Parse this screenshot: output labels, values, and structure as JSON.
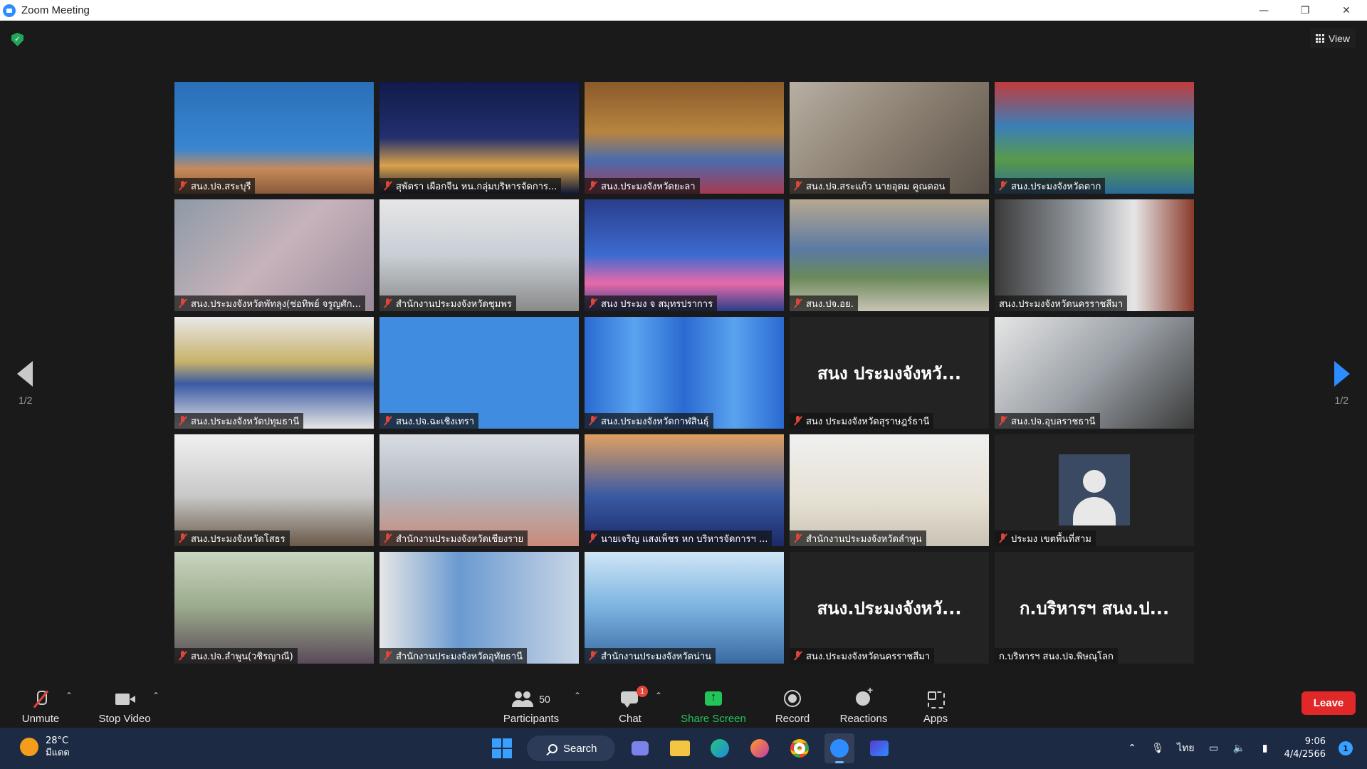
{
  "window": {
    "title": "Zoom Meeting"
  },
  "header": {
    "view_label": "View"
  },
  "pagination": {
    "left": "1/2",
    "right": "1/2"
  },
  "tiles": [
    {
      "name": "สนง.ปจ.สระบุรี",
      "bg": "linear-gradient(180deg,#2a6fb8 0%,#3a86d1 60%,#c68a5a 78%,#8a5a3a 100%)",
      "muted": true
    },
    {
      "name": "สุพัตรา เผือกจีน  หน.กลุ่มบริหารจัดการ...",
      "bg": "linear-gradient(180deg,#101a4a 0%,#23306e 50%,#d9a24a 75%,#0e1838 100%)",
      "muted": true
    },
    {
      "name": "สนง.ประมงจังหวัดยะลา",
      "bg": "linear-gradient(180deg,#8a5a2a 0%,#b88440 45%,#4a6cae 70%,#a63a52 100%)",
      "muted": true
    },
    {
      "name": "สนง.ปจ.สระแก้ว นายอุดม คูณดอน",
      "bg": "linear-gradient(135deg,#b7b0a3 0%,#8a7e70 50%,#5a5249 100%)",
      "muted": true
    },
    {
      "name": "สนง.ประมงจังหวัดตาก",
      "bg": "linear-gradient(180deg,#c23b3b 0%,#3a7fb8 40%,#5a9a4a 70%,#2a6a9a 100%)",
      "muted": true
    },
    {
      "name": "สนง.ประมงจังหวัดพัทลุง(ช่อทิพย์ จรูญศัก...",
      "bg": "linear-gradient(135deg,#8c9aa6 0%,#c7b3bb 50%,#9a8a9a 100%)",
      "muted": true
    },
    {
      "name": "สำนักงานประมงจังหวัดชุมพร",
      "bg": "linear-gradient(180deg,#e6e6e6 0%,#c9cfd6 50%,#8a8a8a 100%)",
      "muted": true
    },
    {
      "name": "สนง ประมง จ สมุทรปราการ",
      "bg": "linear-gradient(180deg,#2a3e8a 0%,#3c6bd1 50%,#e86aa8 75%,#2a3e8a 100%)",
      "muted": true
    },
    {
      "name": "สนง.ปจ.อย.",
      "bg": "linear-gradient(180deg,#b7a890 0%,#5a7aa3 45%,#6a8a5a 70%,#c9c3b5 100%)",
      "muted": true
    },
    {
      "name": "สนง.ประมงจังหวัดนครราชสีมา",
      "bg": "linear-gradient(90deg,#3a3a3a 0%,#9aa0a6 45%,#e6e6e6 70%,#8a3a2a 100%)",
      "muted": false
    },
    {
      "name": "สนง.ประมงจังหวัดปทุมธานี",
      "bg": "linear-gradient(180deg,#e8e8e8 0%,#c9b26a 40%,#3a5aa3 60%,#e6e6e6 100%)",
      "muted": true
    },
    {
      "name": "สนง.ปจ.ฉะเชิงเทรา",
      "bg": "#3f8ce0",
      "muted": true
    },
    {
      "name": "สนง.ประมงจังหวัดกาฬสินธุ์",
      "bg": "linear-gradient(90deg,#2a6ad1 0%,#5aa3f0 25%,#2a6ad1 50%,#5aa3f0 75%,#2a6ad1 100%)",
      "muted": true
    },
    {
      "name": "สนง ประมงจังหวัดสุราษฎร์ธานี",
      "big": "สนง ประมงจังหวั...",
      "bg": "#232323",
      "muted": true
    },
    {
      "name": "สนง.ปจ.อุบลราชธานี",
      "bg": "linear-gradient(135deg,#e6e6e6 0%,#9aa0a6 50%,#3a3a3a 100%)",
      "muted": true
    },
    {
      "name": "สนง.ประมงจังหวัดโสธร",
      "bg": "linear-gradient(180deg,#f0f0f0 0%,#c9c9c9 55%,#6a5a4a 100%)",
      "muted": true
    },
    {
      "name": "สำนักงานประมงจังหวัดเชียงราย",
      "bg": "linear-gradient(180deg,#d9dde3 0%,#b3b8c0 50%,#c98a7a 100%)",
      "muted": true
    },
    {
      "name": "นายเจริญ แสงเพ็ชร หก บริหารจัดการฯ ...",
      "bg": "linear-gradient(180deg,#e0a060 0%,#3a5aa3 55%,#1a2a6a 100%)",
      "muted": true
    },
    {
      "name": "สำนักงานประมงจังหวัดลำพูน",
      "bg": "linear-gradient(180deg,#f0f0f0 0%,#e6e0d3 60%,#c9c3b5 100%)",
      "muted": true
    },
    {
      "name": "ประมง เขตพื้นที่สาม",
      "bg": "#232323",
      "avatar": true,
      "muted": true
    },
    {
      "name": "สนง.ปจ.ลำพูน(วชิรญาณี)",
      "bg": "linear-gradient(180deg,#c9d6c0 0%,#9aaa8a 50%,#5a4a5a 100%)",
      "muted": true
    },
    {
      "name": "สำนักงานประมงจังหวัดอุทัยธานี",
      "bg": "linear-gradient(90deg,#e6e6e6 0%,#6a9ad1 40%,#c9d6e6 100%)",
      "muted": true
    },
    {
      "name": "สำนักงานประมงจังหวัดน่าน",
      "bg": "linear-gradient(180deg,#cfe6f5 0%,#7ab3e0 50%,#3a6aa3 100%)",
      "muted": true
    },
    {
      "name": "สนง.ประมงจังหวัดนครราชสีมา",
      "big": "สนง.ประมงจังหวั...",
      "bg": "#232323",
      "muted": true
    },
    {
      "name": "ก.บริหารฯ สนง.ปจ.พิษณุโลก",
      "big": "ก.บริหารฯ สนง.ป...",
      "bg": "#232323",
      "muted": false
    }
  ],
  "toolbar": {
    "unmute": "Unmute",
    "stop_video": "Stop Video",
    "participants": "Participants",
    "participants_count": "50",
    "chat": "Chat",
    "chat_badge": "1",
    "share_screen": "Share Screen",
    "record": "Record",
    "reactions": "Reactions",
    "apps": "Apps",
    "leave": "Leave"
  },
  "taskbar": {
    "temp": "28°C",
    "weather_desc": "มีแดด",
    "search": "Search",
    "lang": "ไทย",
    "time": "9:06",
    "date": "4/4/2566",
    "notif_count": "1"
  },
  "colors": {
    "accent": "#2d8cff",
    "share_green": "#23c45a",
    "leave_red": "#e02828",
    "muted_red": "#e0453a"
  }
}
